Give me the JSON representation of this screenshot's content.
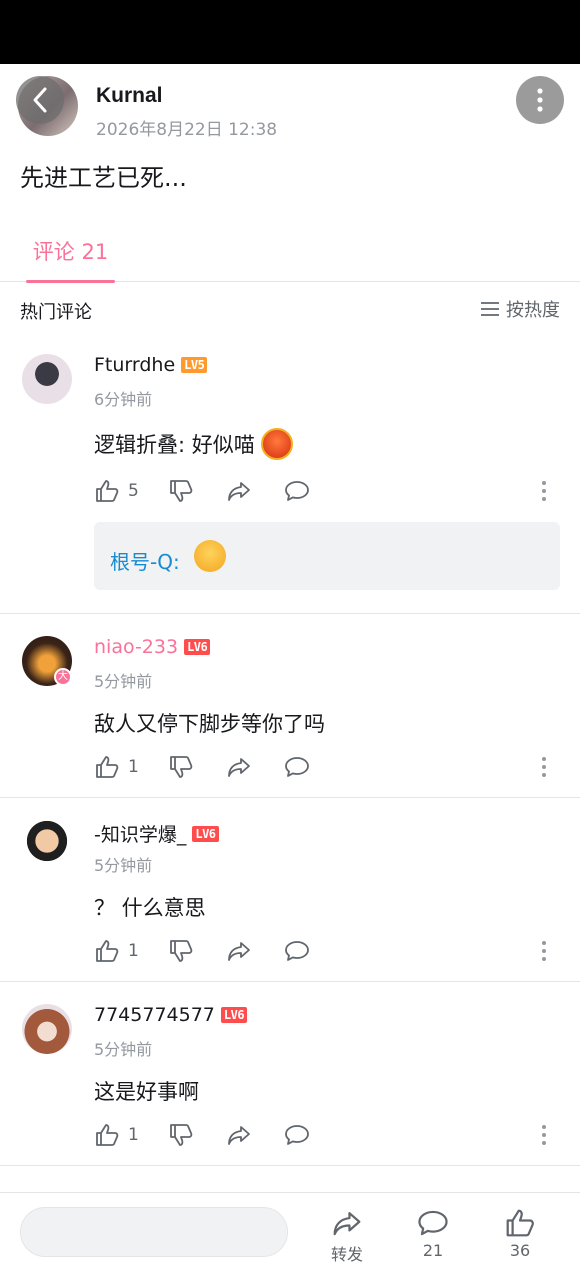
{
  "post": {
    "author": "Kurnal",
    "time": "2026年8月22日 12:38",
    "content": "先进工艺已死..."
  },
  "tabs": {
    "comments": "评论 21"
  },
  "section": {
    "title": "热门评论",
    "sort": "按热度"
  },
  "comments": [
    {
      "user": "Fturrdhe",
      "level": "LV5",
      "time": "6分钟前",
      "text": "逻辑折叠: 好似喵",
      "likes": "5",
      "reply_user": "根号-Q:"
    },
    {
      "user": "niao-233",
      "level": "LV6",
      "time": "5分钟前",
      "text": "敌人又停下脚步等你了吗",
      "likes": "1",
      "avatar_badge": "大"
    },
    {
      "user": "-知识学爆_",
      "level": "LV6",
      "time": "5分钟前",
      "text": "？ 什么意思",
      "likes": "1"
    },
    {
      "user": "7745774577",
      "level": "LV6",
      "time": "5分钟前",
      "text": "这是好事啊",
      "likes": "1"
    }
  ],
  "bottom": {
    "share": "转发",
    "comments": "21",
    "likes": "36"
  },
  "colors": {
    "accent": "#fb7299",
    "link": "#178bcf",
    "muted": "#9499a0"
  }
}
